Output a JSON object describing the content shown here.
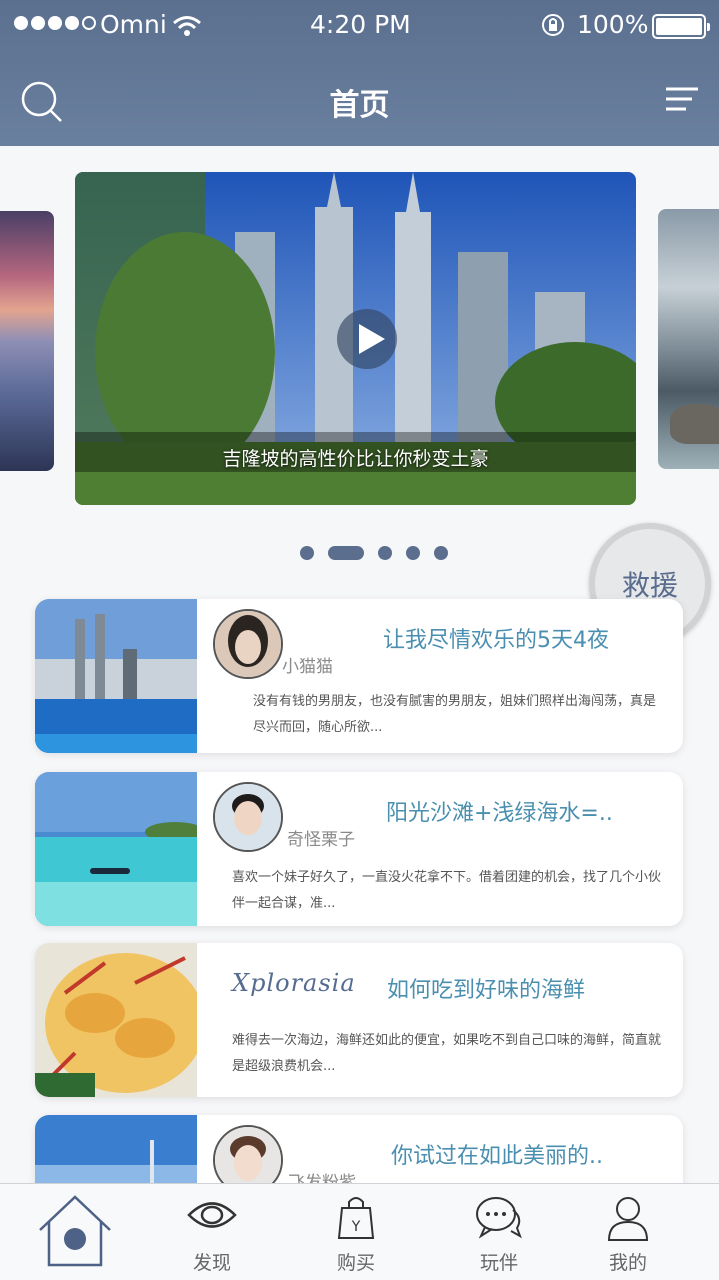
{
  "status_bar": {
    "carrier": "Omni",
    "time": "4:20 PM",
    "battery": "100%"
  },
  "header": {
    "title": "首页",
    "search_icon": "search-icon",
    "menu_icon": "menu-icon"
  },
  "carousel": {
    "caption": "吉隆坡的高性价比让你秒变土豪",
    "page_count": 5,
    "active_page": 2
  },
  "rescue_button": "救援",
  "posts": [
    {
      "author": "小猫猫",
      "title": "让我尽情欢乐的5天4夜",
      "excerpt": "没有有钱的男朋友，也没有腻害的男朋友，姐妹们照样出海闯荡，真是尽兴而回，随心所欲..."
    },
    {
      "author": "奇怪栗子",
      "title": "阳光沙滩+浅绿海水=..",
      "excerpt": "喜欢一个妹子好久了，一直没火花拿不下。借着团建的机会，找了几个小伙伴一起合谋，准..."
    },
    {
      "author": "Xplorasia",
      "title": "如何吃到好味的海鲜",
      "excerpt": "难得去一次海边，海鲜还如此的便宜，如果吃不到自己口味的海鲜，简直就是超级浪费机会..."
    },
    {
      "author": "飞发粉紫",
      "title": "你试过在如此美丽的..",
      "excerpt": ""
    }
  ],
  "tabs": [
    {
      "label": "",
      "icon": "home-icon"
    },
    {
      "label": "发现",
      "icon": "eye-icon"
    },
    {
      "label": "购买",
      "icon": "shopping-bag-icon"
    },
    {
      "label": "玩伴",
      "icon": "chat-icon"
    },
    {
      "label": "我的",
      "icon": "user-icon"
    }
  ],
  "colors": {
    "header": "#62789a",
    "accent": "#5b6e8e",
    "title_blue": "#4a8fb0"
  }
}
